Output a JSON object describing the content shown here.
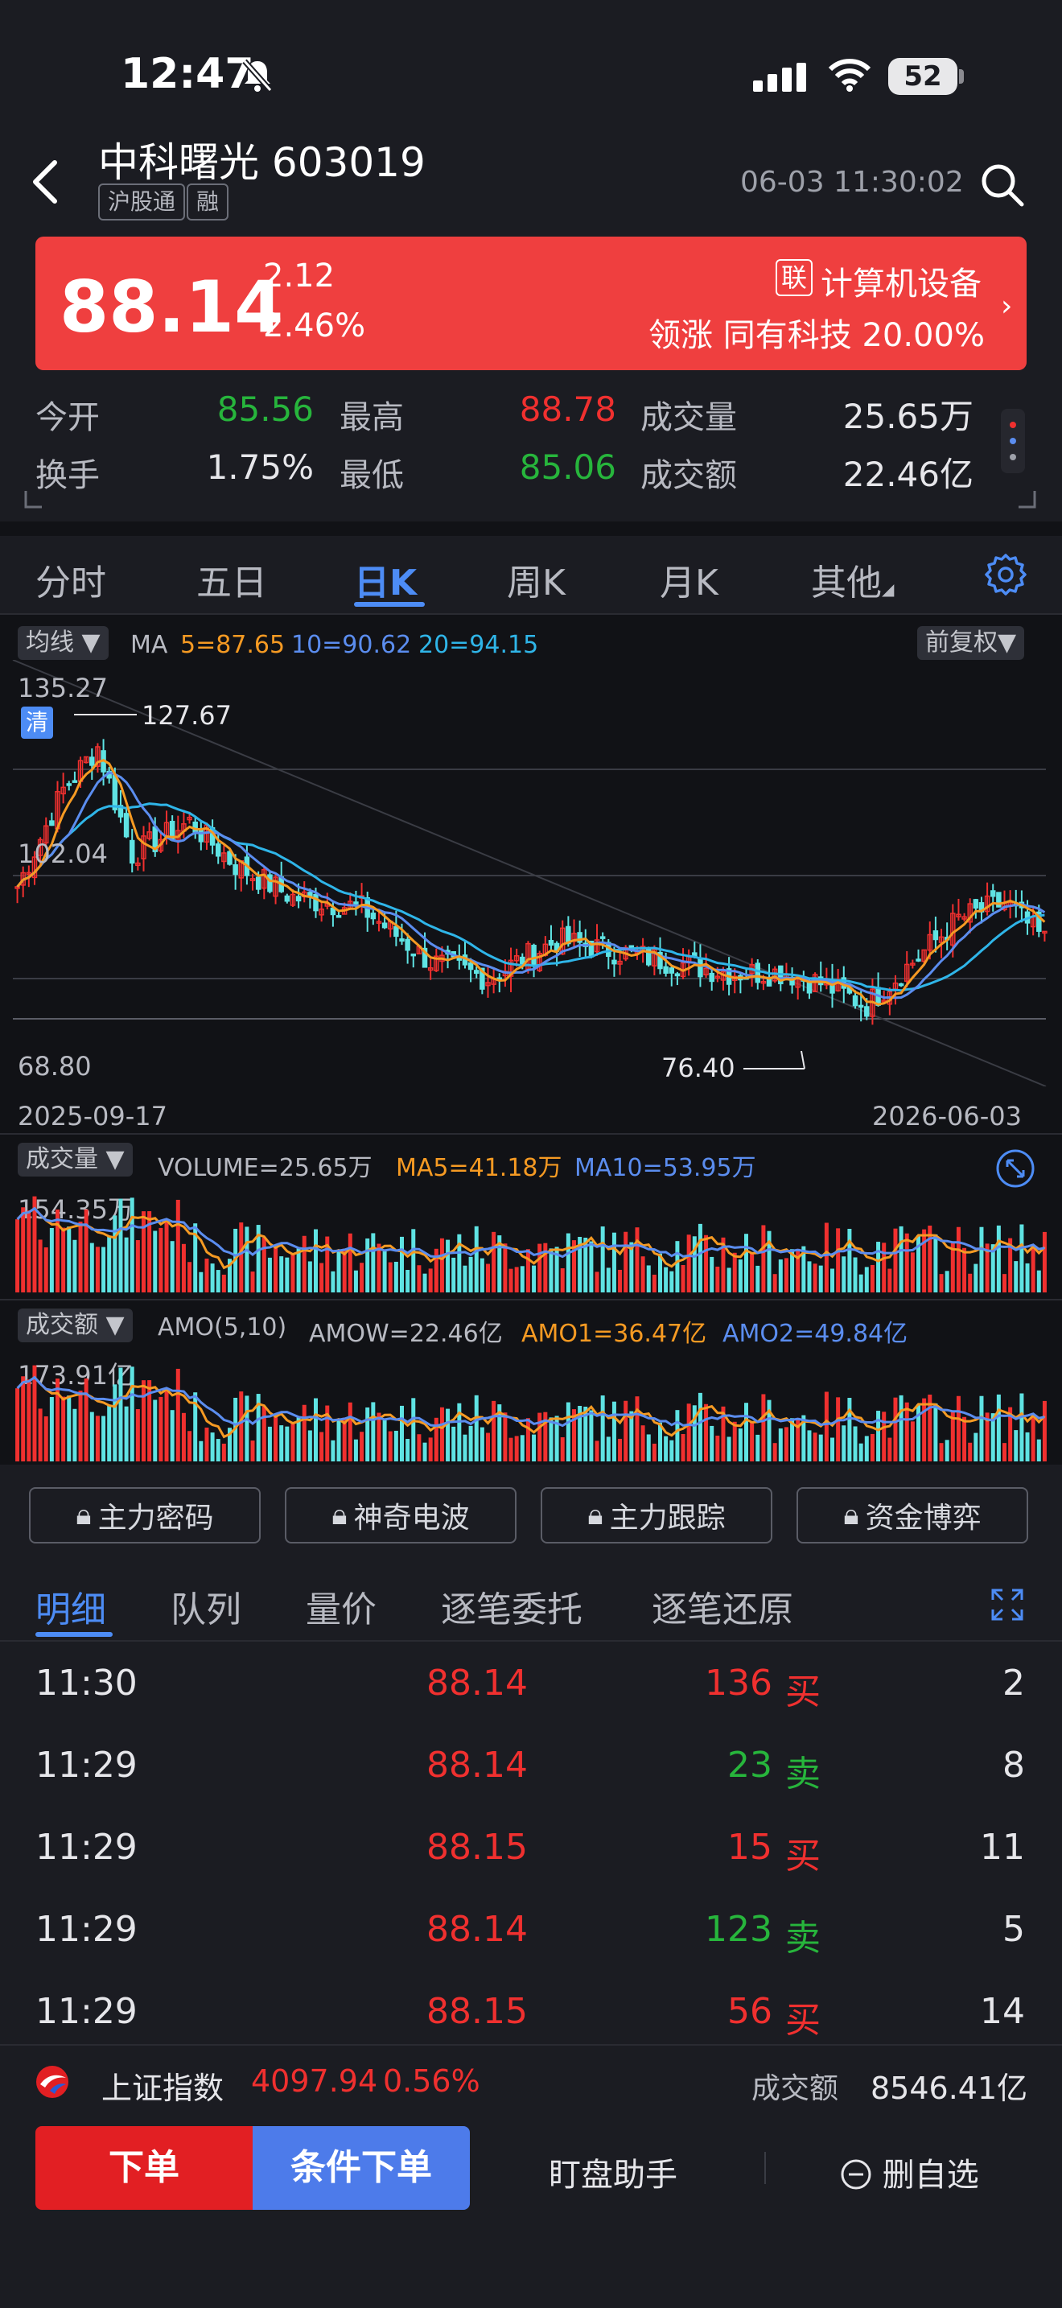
{
  "status": {
    "time": "12:47",
    "battery": "52"
  },
  "header": {
    "name": "中科曙光",
    "code": "603019",
    "tags": [
      "沪股通",
      "融"
    ],
    "datetime": "06-03 11:30:02"
  },
  "quote": {
    "price": "88.14",
    "change": "2.12",
    "change_pct": "2.46%",
    "sector_tag": "联",
    "sector": "计算机设备",
    "leader_label": "领涨",
    "leader_name": "同有科技",
    "leader_pct": "20.00%",
    "open_label": "今开",
    "open": "85.56",
    "high_label": "最高",
    "high": "88.78",
    "vol_label": "成交量",
    "vol": "25.65万",
    "turnover_label": "换手",
    "turnover": "1.75%",
    "low_label": "最低",
    "low": "85.06",
    "amount_label": "成交额",
    "amount": "22.46亿"
  },
  "tabs": [
    "分时",
    "五日",
    "日K",
    "周K",
    "月K",
    "其他"
  ],
  "chart": {
    "ma_selector": "均线",
    "ma_prefix": "MA",
    "ma5": "5=87.65",
    "ma10": "10=90.62",
    "ma20": "20=94.15",
    "adjust": "前复权",
    "y_top": "135.27",
    "y_mid": "102.04",
    "y_bottom": "68.80",
    "high_mark": "127.67",
    "low_mark": "76.40",
    "qing": "清",
    "date_start": "2025-09-17",
    "date_end": "2026-06-03",
    "vol_selector": "成交量",
    "vol_text": "VOLUME=25.65万",
    "vol_ma5": "MA5=41.18万",
    "vol_ma10": "MA10=53.95万",
    "vol_max": "154.35万",
    "amo_selector": "成交额",
    "amo_text": "AMO(5,10)",
    "amo_w": "AMOW=22.46亿",
    "amo1": "AMO1=36.47亿",
    "amo2": "AMO2=49.84亿",
    "amo_max": "173.91亿",
    "colors": {
      "up": "#f0302f",
      "down": "#5fe3e3",
      "ma5": "#f59a23",
      "ma10": "#5b8def",
      "ma20": "#2fb5e8"
    }
  },
  "locked_tools": [
    "主力密码",
    "神奇电波",
    "主力跟踪",
    "资金博弈"
  ],
  "detail_tabs": [
    "明细",
    "队列",
    "量价",
    "逐笔委托",
    "逐笔还原"
  ],
  "trades": [
    {
      "time": "11:30",
      "price": "88.14",
      "volume": "136",
      "side": "买",
      "count": "2"
    },
    {
      "time": "11:29",
      "price": "88.14",
      "volume": "23",
      "side": "卖",
      "count": "8"
    },
    {
      "time": "11:29",
      "price": "88.15",
      "volume": "15",
      "side": "买",
      "count": "11"
    },
    {
      "time": "11:29",
      "price": "88.14",
      "volume": "123",
      "side": "卖",
      "count": "5"
    },
    {
      "time": "11:29",
      "price": "88.15",
      "volume": "56",
      "side": "买",
      "count": "14"
    }
  ],
  "index": {
    "name": "上证指数",
    "value": "4097.94",
    "pct": "0.56%",
    "amount_label": "成交额",
    "amount": "8546.41亿"
  },
  "actions": {
    "order": "下单",
    "conditional": "条件下单",
    "helper": "盯盘助手",
    "remove": "删自选"
  }
}
